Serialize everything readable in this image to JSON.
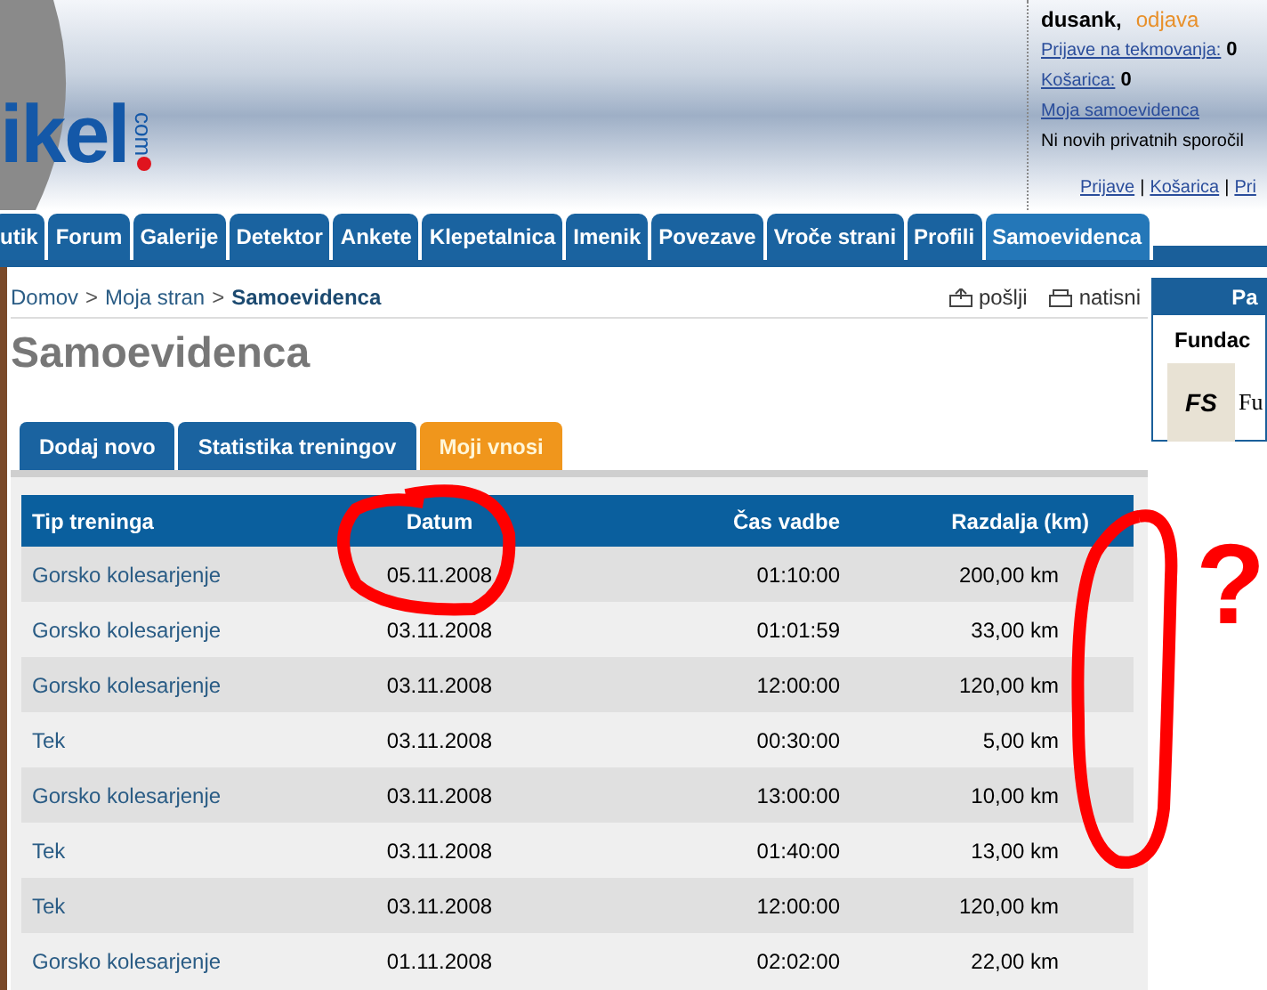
{
  "header": {
    "logo": "ikel",
    "logo_suffix": "com",
    "user": {
      "name": "dusank,",
      "logout": "odjava",
      "links": [
        {
          "label": "Prijave na tekmovanja:",
          "count": "0"
        },
        {
          "label": "Košarica:",
          "count": "0"
        },
        {
          "label": "Moja samoevidenca"
        }
      ],
      "messages": "Ni novih privatnih sporočil",
      "bottom_links": [
        "Prijave",
        "Košarica",
        "Pri"
      ],
      "link_separator": "|"
    }
  },
  "nav": [
    {
      "label": "utik",
      "selected": false
    },
    {
      "label": "Forum",
      "selected": false
    },
    {
      "label": "Galerije",
      "selected": false
    },
    {
      "label": "Detektor",
      "selected": false
    },
    {
      "label": "Ankete",
      "selected": false
    },
    {
      "label": "Klepetalnica",
      "selected": false
    },
    {
      "label": "Imenik",
      "selected": false
    },
    {
      "label": "Povezave",
      "selected": false
    },
    {
      "label": "Vroče strani",
      "selected": false
    },
    {
      "label": "Profili",
      "selected": false
    },
    {
      "label": "Samoevidenca",
      "selected": true
    }
  ],
  "breadcrumb": [
    "Domov",
    "Moja stran",
    "Samoevidenca"
  ],
  "breadcrumb_separator": ">",
  "actions": [
    "pošlji",
    "natisni"
  ],
  "title": "Samoevidenca",
  "tabs": [
    {
      "label": "Dodaj novo",
      "selected": false
    },
    {
      "label": "Statistika treningov",
      "selected": false
    },
    {
      "label": "Moji vnosi",
      "selected": true
    }
  ],
  "table": {
    "columns": [
      "Tip treninga",
      "Datum",
      "Čas vadbe",
      "Razdalja (km)"
    ],
    "rows": [
      [
        "Gorsko kolesarjenje",
        "05.11.2008",
        "01:10:00",
        "200,00 km"
      ],
      [
        "Gorsko kolesarjenje",
        "03.11.2008",
        "01:01:59",
        "33,00 km"
      ],
      [
        "Gorsko kolesarjenje",
        "03.11.2008",
        "12:00:00",
        "120,00 km"
      ],
      [
        "Tek",
        "03.11.2008",
        "00:30:00",
        "5,00 km"
      ],
      [
        "Gorsko kolesarjenje",
        "03.11.2008",
        "13:00:00",
        "10,00 km"
      ],
      [
        "Tek",
        "03.11.2008",
        "01:40:00",
        "13,00 km"
      ],
      [
        "Tek",
        "03.11.2008",
        "12:00:00",
        "120,00 km"
      ],
      [
        "Gorsko kolesarjenje",
        "01.11.2008",
        "02:02:00",
        "22,00 km"
      ]
    ]
  },
  "sidebar": {
    "heading": "Pa",
    "sponsor": "Fundac",
    "logo_text": "FS",
    "logo_caption": "Fu"
  },
  "annotation": {
    "mark": "?"
  }
}
